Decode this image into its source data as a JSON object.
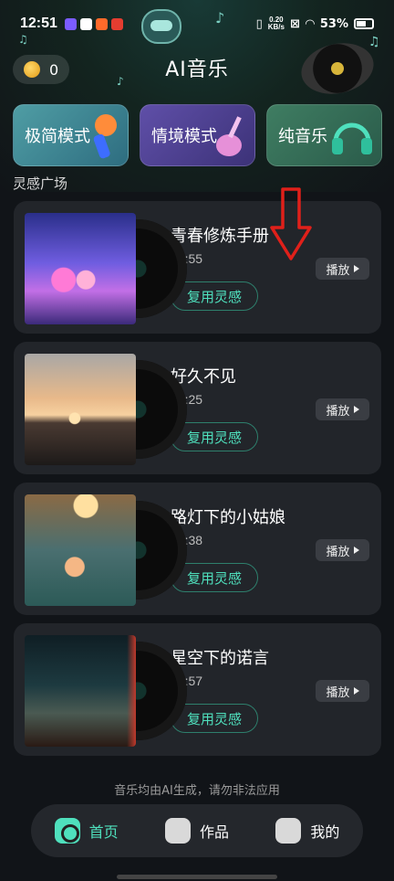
{
  "status_bar": {
    "time": "12:51",
    "speed_top": "0.20",
    "speed_bottom": "KB/s",
    "battery": "53%"
  },
  "header": {
    "coins": "0",
    "title": "AI音乐"
  },
  "modes": [
    {
      "label": "极简模式",
      "icon": "microphone-icon"
    },
    {
      "label": "情境模式",
      "icon": "violin-icon"
    },
    {
      "label": "纯音乐",
      "icon": "headphones-icon"
    }
  ],
  "section_title": "灵感广场",
  "songs": [
    {
      "title": "青春修炼手册",
      "duration": "02:55",
      "reuse": "复用灵感",
      "play": "播放"
    },
    {
      "title": "好久不见",
      "duration": "03:25",
      "reuse": "复用灵感",
      "play": "播放"
    },
    {
      "title": "路灯下的小姑娘",
      "duration": "02:38",
      "reuse": "复用灵感",
      "play": "播放"
    },
    {
      "title": "星空下的诺言",
      "duration": "02:57",
      "reuse": "复用灵感",
      "play": "播放"
    }
  ],
  "footer": {
    "disclaimer": "音乐均由AI生成，请勿非法应用"
  },
  "tabs": [
    {
      "label": "首页",
      "active": true,
      "icon": "home-music-icon"
    },
    {
      "label": "作品",
      "active": false,
      "icon": "works-headphone-icon"
    },
    {
      "label": "我的",
      "active": false,
      "icon": "user-icon"
    }
  ],
  "colors": {
    "accent": "#4fe0bd",
    "annotation_arrow": "#e0201a"
  }
}
